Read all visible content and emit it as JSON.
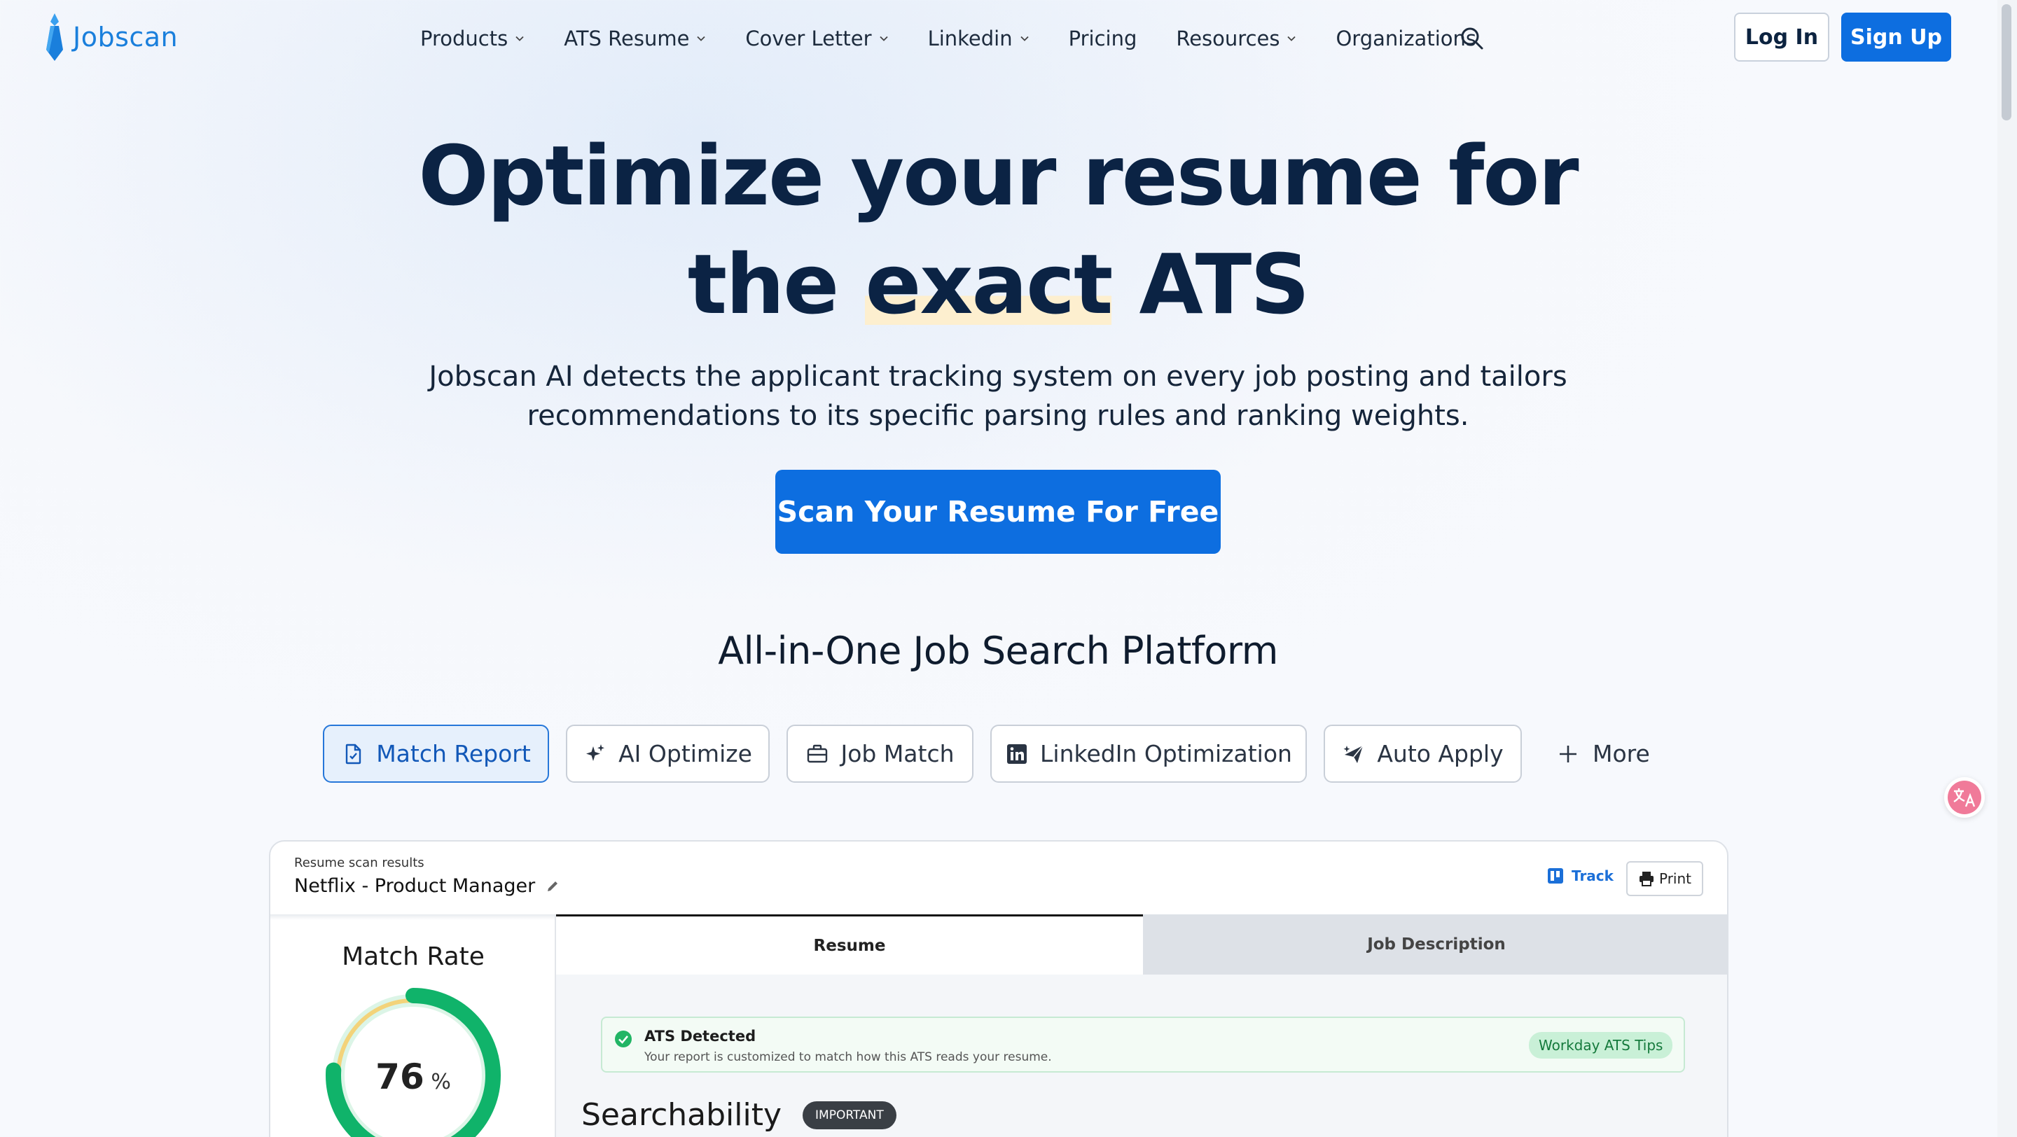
{
  "nav": {
    "logo_text": "Jobscan",
    "items": [
      {
        "label": "Products",
        "dropdown": true
      },
      {
        "label": "ATS Resume",
        "dropdown": true
      },
      {
        "label": "Cover Letter",
        "dropdown": true
      },
      {
        "label": "Linkedin",
        "dropdown": true
      },
      {
        "label": "Pricing",
        "dropdown": false
      },
      {
        "label": "Resources",
        "dropdown": true
      },
      {
        "label": "Organizations",
        "dropdown": false
      }
    ],
    "login_label": "Log In",
    "signup_label": "Sign Up"
  },
  "hero": {
    "title_line1": "Optimize your resume for",
    "title_line2_pre": "the ",
    "title_line2_highlight": "exact",
    "title_line2_post": " ATS",
    "subtitle_line1": "Jobscan AI detects the applicant tracking system on every job posting and tailors",
    "subtitle_line2": "recommendations to its specific parsing rules and ranking weights.",
    "cta_label": "Scan Your Resume For Free"
  },
  "platform": {
    "heading": "All-in-One Job Search Platform",
    "tabs": [
      {
        "label": "Match Report",
        "icon": "document-icon",
        "active": true
      },
      {
        "label": "AI Optimize",
        "icon": "sparkle-icon",
        "active": false
      },
      {
        "label": "Job Match",
        "icon": "briefcase-icon",
        "active": false
      },
      {
        "label": "LinkedIn Optimization",
        "icon": "linkedin-icon",
        "active": false
      },
      {
        "label": "Auto Apply",
        "icon": "plane-icon",
        "active": false
      }
    ],
    "more_label": "More"
  },
  "report": {
    "top_label": "Resume scan results",
    "title": "Netflix - Product Manager",
    "track_label": "Track",
    "print_label": "Print",
    "match_rate_label": "Match Rate",
    "match_rate_value": "76",
    "match_rate_unit": "%",
    "match_rate_fraction": 0.76,
    "tab_resume": "Resume",
    "tab_job_description": "Job Description",
    "ats_title": "ATS Detected",
    "ats_desc": "Your report is customized to match how this ATS reads your resume.",
    "ats_tag": "Workday ATS Tips",
    "section_heading": "Searchability",
    "section_badge": "IMPORTANT"
  },
  "colors": {
    "brand_blue": "#0d6ee0",
    "navy_text": "#0b2344",
    "highlight": "#fdefcf",
    "gauge_green": "#10b36a",
    "gauge_yellow": "#f3d37a"
  }
}
